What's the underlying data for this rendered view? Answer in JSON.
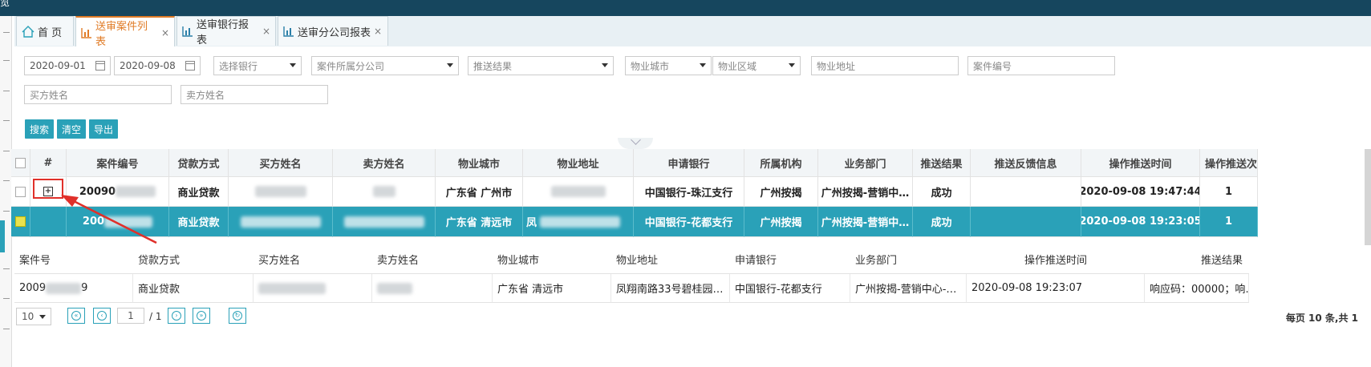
{
  "app": {
    "title": "览"
  },
  "tabs": [
    {
      "label": "首 页",
      "icon": "home-icon",
      "closable": false,
      "active": false
    },
    {
      "label": "送审案件列表",
      "icon": "bar-chart-icon",
      "closable": true,
      "active": true
    },
    {
      "label": "送审银行报表",
      "icon": "bar-chart-icon",
      "closable": true,
      "active": false
    },
    {
      "label": "送审分公司报表",
      "icon": "bar-chart-icon",
      "closable": true,
      "active": false
    }
  ],
  "close_glyph": "×",
  "filters": {
    "date_from": "2020-09-01",
    "date_to": "2020-09-08",
    "bank": "选择银行",
    "branch": "案件所属分公司",
    "push_result": "推送结果",
    "city": "物业城市",
    "district": "物业区域",
    "address": "物业地址",
    "case_no": "案件编号",
    "buyer": "买方姓名",
    "seller": "卖方姓名"
  },
  "buttons": {
    "search": "搜索",
    "clear": "清空",
    "export": "导出"
  },
  "table": {
    "headers": [
      "#",
      "案件编号",
      "贷款方式",
      "买方姓名",
      "卖方姓名",
      "物业城市",
      "物业地址",
      "申请银行",
      "所属机构",
      "业务部门",
      "推送结果",
      "推送反馈信息",
      "操作推送时间",
      "操作推送次"
    ],
    "rows": [
      {
        "case_no": "20090",
        "loan": "商业贷款",
        "city": "广东省 广州市",
        "bank": "中国银行-珠江支行",
        "org": "广州按揭",
        "dept": "广州按揭-营销中…",
        "result": "成功",
        "feedback": "",
        "time": "2020-09-08 19:47:44",
        "count": "1",
        "expand": "+"
      },
      {
        "case_no": "200",
        "loan": "商业贷款",
        "city": "广东省 清远市",
        "address_prefix": "凤",
        "bank": "中国银行-花都支行",
        "org": "广州按揭",
        "dept": "广州按揭-营销中…",
        "result": "成功",
        "feedback": "",
        "time": "2020-09-08 19:23:05",
        "count": "1"
      }
    ]
  },
  "subtable": {
    "headers": [
      "案件号",
      "贷款方式",
      "买方姓名",
      "卖方姓名",
      "物业城市",
      "物业地址",
      "申请银行",
      "业务部门",
      "操作推送时间",
      "推送结果"
    ],
    "row": {
      "case_no_a": "2009",
      "case_no_b": "9",
      "loan": "商业贷款",
      "city": "广东省 清远市",
      "address": "凤翔南路33号碧桂园…",
      "bank": "中国银行-花都支行",
      "dept": "广州按揭-营销中心-…",
      "time": "2020-09-08 19:23:07",
      "result": "响应码：00000；响…"
    }
  },
  "pager": {
    "page_size": "10",
    "current_page": "1",
    "total_pages": "/ 1",
    "summary": "每页 10 条,共 1"
  },
  "colors": {
    "accent": "#2aa1b8",
    "active_tab": "#e07b26",
    "topbar": "#16465e",
    "highlight": "#e0302a"
  }
}
